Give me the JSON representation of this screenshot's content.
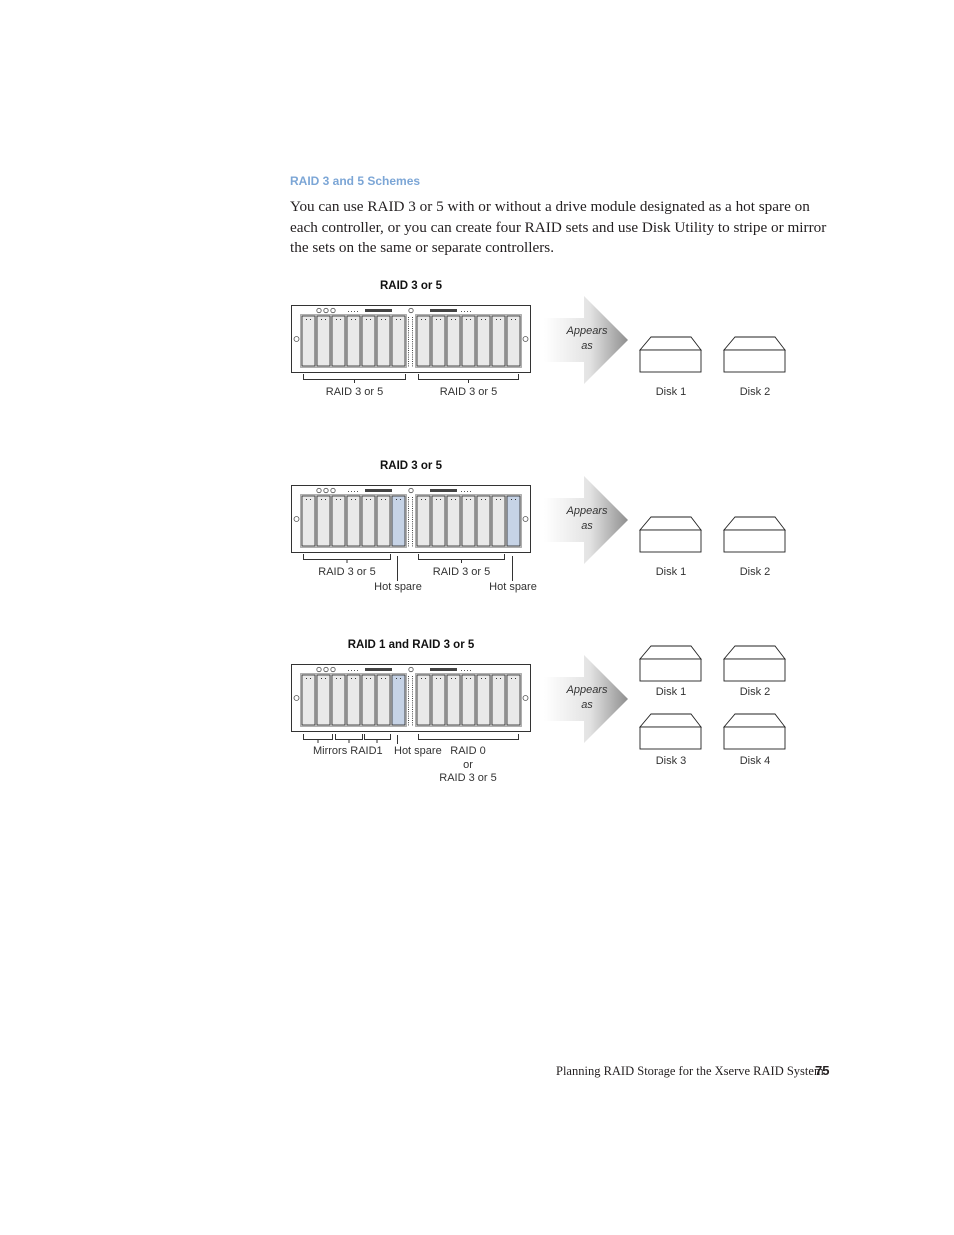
{
  "section": {
    "heading": "RAID 3 and 5 Schemes",
    "paragraph": "You can use RAID 3 or 5 with or without a drive module designated as a hot spare on each controller, or you can create four RAID sets and use Disk Utility to stripe or mirror the sets on the same or separate controllers."
  },
  "colors": {
    "heading": "#7ca6d6",
    "hot_spare_drive": "#c6d3e6",
    "drive": "#e9e9e9"
  },
  "figures": [
    {
      "title": "RAID 3 or 5",
      "hot_spare_slots": [],
      "labels": {
        "left_group": "RAID 3 or 5",
        "right_group": "RAID 3 or 5"
      },
      "arrow_label_line1": "Appears",
      "arrow_label_line2": "as",
      "disks": [
        "Disk 1",
        "Disk 2"
      ]
    },
    {
      "title": "RAID 3 or 5",
      "hot_spare_slots": [
        6,
        13
      ],
      "labels": {
        "left_group": "RAID 3 or 5",
        "right_group": "RAID 3 or 5",
        "left_hot_spare": "Hot spare",
        "right_hot_spare": "Hot spare"
      },
      "arrow_label_line1": "Appears",
      "arrow_label_line2": "as",
      "disks": [
        "Disk 1",
        "Disk 2"
      ]
    },
    {
      "title": "RAID 1 and RAID 3 or 5",
      "hot_spare_slots": [
        6
      ],
      "labels": {
        "mirrors": "Mirrors RAID1",
        "hot_spare": "Hot spare",
        "raid0_line1": "RAID 0",
        "raid0_line2": "or",
        "raid0_line3": "RAID 3 or 5"
      },
      "arrow_label_line1": "Appears",
      "arrow_label_line2": "as",
      "disks": [
        "Disk 1",
        "Disk 2",
        "Disk 3",
        "Disk 4"
      ]
    }
  ],
  "footer": {
    "chapter_title": "Planning RAID Storage for the Xserve RAID System",
    "page_number": "75"
  }
}
